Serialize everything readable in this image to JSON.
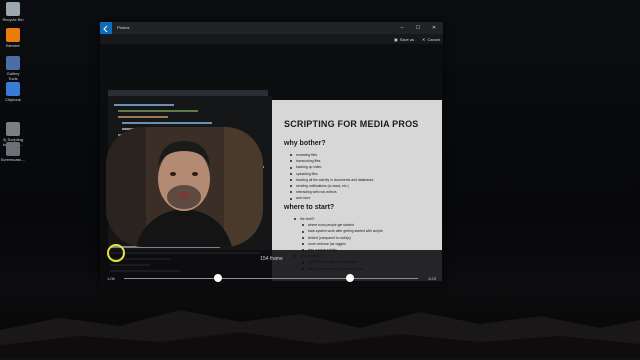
{
  "desktop": {
    "icons": [
      {
        "label": "Recycle Bin",
        "color": "#9ea7ad"
      },
      {
        "label": "Blender",
        "color": "#e87d0d"
      },
      {
        "label": "Gallery\nTools",
        "color": "#4a6fa5"
      },
      {
        "label": "Citybook",
        "color": "#3a7bd5"
      },
      {
        "label": "3) Scripting\nfor Media...",
        "color": "#7a7f86"
      },
      {
        "label": "Screencast-...",
        "color": "#6b7076"
      }
    ]
  },
  "window": {
    "app_label": "Photos",
    "actions": {
      "save": "Save as",
      "cancel": "Cancel"
    },
    "caption_buttons": {
      "minimize": "–",
      "maximize": "☐",
      "close": "✕"
    }
  },
  "slide": {
    "title": "SCRIPTING FOR MEDIA PROS",
    "section1": "why bother?",
    "bullets1": [
      "renaming files",
      "transcoding files",
      "backing up video",
      "uploading files",
      "tracking all the activity in documents and databases",
      "sending notifications (to slack, etc.)",
      "interacting with non-editors",
      "and more"
    ],
    "section2": "where to start?",
    "bullets2": [
      "the shell?",
      "where most people get started",
      "bare-system work after getting started with scripts",
      "limited (compared to nodejs)",
      "more verbose (as viggins",
      "less current activity",
      "why js with js?",
      "HUGE community of developers",
      "they'll do hands on your work for you"
    ]
  },
  "playback": {
    "frame_label": "154 frame",
    "current_time": "1:06",
    "duration": "3:23",
    "trim_start_fraction": 0.32,
    "trim_end_fraction": 0.77
  }
}
